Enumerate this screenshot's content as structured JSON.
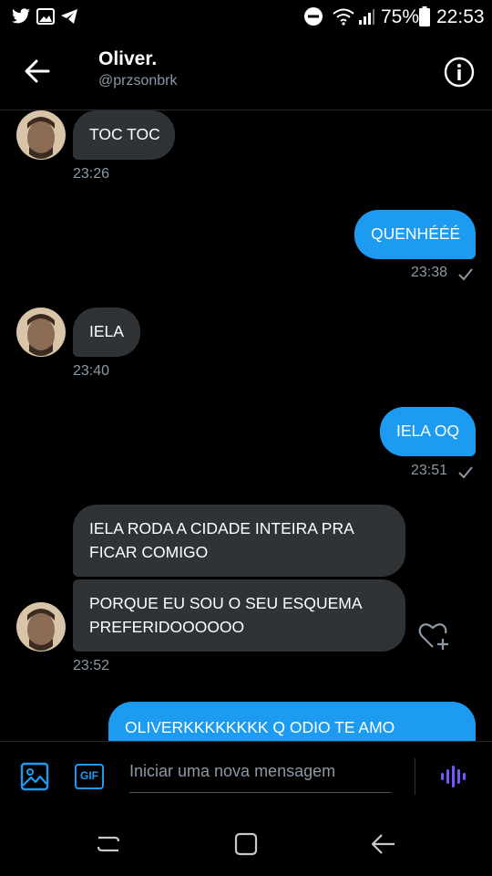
{
  "status_bar": {
    "battery": "75%",
    "time": "22:53"
  },
  "header": {
    "name": "Oliver.",
    "handle": "@przsonbrk"
  },
  "messages": [
    {
      "direction": "in",
      "text": "TOC TOC",
      "time": "23:26"
    },
    {
      "direction": "out",
      "text": "QUENHÉÉÉ",
      "time": "23:38"
    },
    {
      "direction": "in",
      "text": "IELA",
      "time": "23:40"
    },
    {
      "direction": "out",
      "text": "IELA OQ",
      "time": "23:51"
    },
    {
      "direction": "in",
      "text": "IELA RODA A CIDADE INTEIRA PRA FICAR COMIGO",
      "time": ""
    },
    {
      "direction": "in",
      "text": "PORQUE EU SOU O SEU ESQUEMA PREFERIDOOOOOO",
      "time": "23:52"
    },
    {
      "direction": "out",
      "text": "OLIVERKKKKKKKK Q ODIO TE AMO",
      "time": ""
    }
  ],
  "composer": {
    "placeholder": "Iniciar uma nova mensagem",
    "gif_label": "GIF"
  },
  "colors": {
    "outgoing_bubble": "#1d9bf0",
    "incoming_bubble": "#2f3336",
    "muted_text": "#8b98a5",
    "voice_icon": "#7856ff"
  }
}
